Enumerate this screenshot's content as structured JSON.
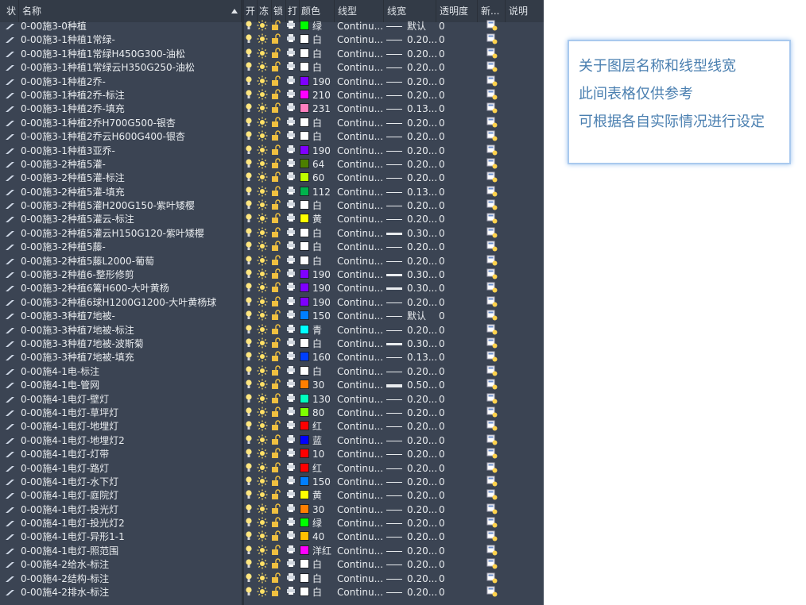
{
  "headers": {
    "status": "状",
    "name": "名称",
    "on": "开",
    "freeze": "冻",
    "lock": "锁",
    "plot": "打",
    "color": "颜色",
    "linetype": "线型",
    "lineweight": "线宽",
    "transparency": "透明度",
    "new_vp_freeze": "新...",
    "description": "说明"
  },
  "colors": {
    "panel_bg": "#3b4453",
    "header_bg": "#333b47",
    "note_text": "#4a7fb0",
    "note_border": "#a9c9ee"
  },
  "layers": [
    {
      "name": "0-00施3-0种植",
      "color_label": "绿",
      "swatch": "#00ff00",
      "linetype": "Continu...",
      "lineweight": "默认",
      "lw_weight": 1,
      "transparency": "0"
    },
    {
      "name": "0-00施3-1种植1常绿-",
      "color_label": "白",
      "swatch": "#ffffff",
      "linetype": "Continu...",
      "lineweight": "0.20...",
      "lw_weight": 1,
      "transparency": "0"
    },
    {
      "name": "0-00施3-1种植1常绿H450G300-油松",
      "color_label": "白",
      "swatch": "#ffffff",
      "linetype": "Continu...",
      "lineweight": "0.20...",
      "lw_weight": 1,
      "transparency": "0"
    },
    {
      "name": "0-00施3-1种植1常绿云H350G250-油松",
      "color_label": "白",
      "swatch": "#ffffff",
      "linetype": "Continu...",
      "lineweight": "0.20...",
      "lw_weight": 1,
      "transparency": "0"
    },
    {
      "name": "0-00施3-1种植2乔-",
      "color_label": "190",
      "swatch": "#7f00ff",
      "linetype": "Continu...",
      "lineweight": "0.20...",
      "lw_weight": 1,
      "transparency": "0"
    },
    {
      "name": "0-00施3-1种植2乔-标注",
      "color_label": "210",
      "swatch": "#ff00ff",
      "linetype": "Continu...",
      "lineweight": "0.20...",
      "lw_weight": 1,
      "transparency": "0"
    },
    {
      "name": "0-00施3-1种植2乔-填充",
      "color_label": "231",
      "swatch": "#ff7fbf",
      "linetype": "Continu...",
      "lineweight": "0.13...",
      "lw_weight": 1,
      "transparency": "0"
    },
    {
      "name": "0-00施3-1种植2乔H700G500-银杏",
      "color_label": "白",
      "swatch": "#ffffff",
      "linetype": "Continu...",
      "lineweight": "0.20...",
      "lw_weight": 1,
      "transparency": "0"
    },
    {
      "name": "0-00施3-1种植2乔云H600G400-银杏",
      "color_label": "白",
      "swatch": "#ffffff",
      "linetype": "Continu...",
      "lineweight": "0.20...",
      "lw_weight": 1,
      "transparency": "0"
    },
    {
      "name": "0-00施3-1种植3亚乔-",
      "color_label": "190",
      "swatch": "#7f00ff",
      "linetype": "Continu...",
      "lineweight": "0.20...",
      "lw_weight": 1,
      "transparency": "0"
    },
    {
      "name": "0-00施3-2种植5灌-",
      "color_label": "64",
      "swatch": "#4c7f00",
      "linetype": "Continu...",
      "lineweight": "0.20...",
      "lw_weight": 1,
      "transparency": "0"
    },
    {
      "name": "0-00施3-2种植5灌-标注",
      "color_label": "60",
      "swatch": "#bfff00",
      "linetype": "Continu...",
      "lineweight": "0.20...",
      "lw_weight": 1,
      "transparency": "0"
    },
    {
      "name": "0-00施3-2种植5灌-填充",
      "color_label": "112",
      "swatch": "#00b24c",
      "linetype": "Continu...",
      "lineweight": "0.13...",
      "lw_weight": 1,
      "transparency": "0"
    },
    {
      "name": "0-00施3-2种植5灌H200G150-紫叶矮樱",
      "color_label": "白",
      "swatch": "#ffffff",
      "linetype": "Continu...",
      "lineweight": "0.20...",
      "lw_weight": 1,
      "transparency": "0"
    },
    {
      "name": "0-00施3-2种植5灌云-标注",
      "color_label": "黄",
      "swatch": "#ffff00",
      "linetype": "Continu...",
      "lineweight": "0.20...",
      "lw_weight": 1,
      "transparency": "0"
    },
    {
      "name": "0-00施3-2种植5灌云H150G120-紫叶矮樱",
      "color_label": "白",
      "swatch": "#ffffff",
      "linetype": "Continu...",
      "lineweight": "0.30...",
      "lw_weight": 3,
      "transparency": "0"
    },
    {
      "name": "0-00施3-2种植5藤-",
      "color_label": "白",
      "swatch": "#ffffff",
      "linetype": "Continu...",
      "lineweight": "0.20...",
      "lw_weight": 1,
      "transparency": "0"
    },
    {
      "name": "0-00施3-2种植5藤L2000-葡萄",
      "color_label": "白",
      "swatch": "#ffffff",
      "linetype": "Continu...",
      "lineweight": "0.20...",
      "lw_weight": 1,
      "transparency": "0"
    },
    {
      "name": "0-00施3-2种植6-整形修剪",
      "color_label": "190",
      "swatch": "#7f00ff",
      "linetype": "Continu...",
      "lineweight": "0.30...",
      "lw_weight": 3,
      "transparency": "0"
    },
    {
      "name": "0-00施3-2种植6篱H600-大叶黄杨",
      "color_label": "190",
      "swatch": "#7f00ff",
      "linetype": "Continu...",
      "lineweight": "0.30...",
      "lw_weight": 3,
      "transparency": "0"
    },
    {
      "name": "0-00施3-2种植6球H1200G1200-大叶黄杨球",
      "color_label": "190",
      "swatch": "#7f00ff",
      "linetype": "Continu...",
      "lineweight": "0.20...",
      "lw_weight": 1,
      "transparency": "0"
    },
    {
      "name": "0-00施3-3种植7地被-",
      "color_label": "150",
      "swatch": "#007fff",
      "linetype": "Continu...",
      "lineweight": "默认",
      "lw_weight": 1,
      "transparency": "0"
    },
    {
      "name": "0-00施3-3种植7地被-标注",
      "color_label": "青",
      "swatch": "#00ffff",
      "linetype": "Continu...",
      "lineweight": "0.20...",
      "lw_weight": 1,
      "transparency": "0"
    },
    {
      "name": "0-00施3-3种植7地被-波斯菊",
      "color_label": "白",
      "swatch": "#ffffff",
      "linetype": "Continu...",
      "lineweight": "0.30...",
      "lw_weight": 3,
      "transparency": "0"
    },
    {
      "name": "0-00施3-3种植7地被-填充",
      "color_label": "160",
      "swatch": "#003fff",
      "linetype": "Continu...",
      "lineweight": "0.13...",
      "lw_weight": 1,
      "transparency": "0"
    },
    {
      "name": "0-00施4-1电-标注",
      "color_label": "白",
      "swatch": "#ffffff",
      "linetype": "Continu...",
      "lineweight": "0.20...",
      "lw_weight": 1,
      "transparency": "0"
    },
    {
      "name": "0-00施4-1电-管网",
      "color_label": "30",
      "swatch": "#ff7f00",
      "linetype": "Continu...",
      "lineweight": "0.50...",
      "lw_weight": 4,
      "transparency": "0"
    },
    {
      "name": "0-00施4-1电灯-壁灯",
      "color_label": "130",
      "swatch": "#00ffbf",
      "linetype": "Continu...",
      "lineweight": "0.20...",
      "lw_weight": 1,
      "transparency": "0"
    },
    {
      "name": "0-00施4-1电灯-草坪灯",
      "color_label": "80",
      "swatch": "#7fff00",
      "linetype": "Continu...",
      "lineweight": "0.20...",
      "lw_weight": 1,
      "transparency": "0"
    },
    {
      "name": "0-00施4-1电灯-地埋灯",
      "color_label": "红",
      "swatch": "#ff0000",
      "linetype": "Continu...",
      "lineweight": "0.20...",
      "lw_weight": 1,
      "transparency": "0"
    },
    {
      "name": "0-00施4-1电灯-地埋灯2",
      "color_label": "蓝",
      "swatch": "#0000ff",
      "linetype": "Continu...",
      "lineweight": "0.20...",
      "lw_weight": 1,
      "transparency": "0"
    },
    {
      "name": "0-00施4-1电灯-灯带",
      "color_label": "10",
      "swatch": "#ff0000",
      "linetype": "Continu...",
      "lineweight": "0.20...",
      "lw_weight": 1,
      "transparency": "0"
    },
    {
      "name": "0-00施4-1电灯-路灯",
      "color_label": "红",
      "swatch": "#ff0000",
      "linetype": "Continu...",
      "lineweight": "0.20...",
      "lw_weight": 1,
      "transparency": "0"
    },
    {
      "name": "0-00施4-1电灯-水下灯",
      "color_label": "150",
      "swatch": "#007fff",
      "linetype": "Continu...",
      "lineweight": "0.20...",
      "lw_weight": 1,
      "transparency": "0"
    },
    {
      "name": "0-00施4-1电灯-庭院灯",
      "color_label": "黄",
      "swatch": "#ffff00",
      "linetype": "Continu...",
      "lineweight": "0.20...",
      "lw_weight": 1,
      "transparency": "0"
    },
    {
      "name": "0-00施4-1电灯-投光灯",
      "color_label": "30",
      "swatch": "#ff7f00",
      "linetype": "Continu...",
      "lineweight": "0.20...",
      "lw_weight": 1,
      "transparency": "0"
    },
    {
      "name": "0-00施4-1电灯-投光灯2",
      "color_label": "绿",
      "swatch": "#00ff00",
      "linetype": "Continu...",
      "lineweight": "0.20...",
      "lw_weight": 1,
      "transparency": "0"
    },
    {
      "name": "0-00施4-1电灯-异形1-1",
      "color_label": "40",
      "swatch": "#ffbf00",
      "linetype": "Continu...",
      "lineweight": "0.20...",
      "lw_weight": 1,
      "transparency": "0"
    },
    {
      "name": "0-00施4-1电灯-照范围",
      "color_label": "洋红",
      "swatch": "#ff00ff",
      "linetype": "Continu...",
      "lineweight": "0.20...",
      "lw_weight": 1,
      "transparency": "0"
    },
    {
      "name": "0-00施4-2给水-标注",
      "color_label": "白",
      "swatch": "#ffffff",
      "linetype": "Continu...",
      "lineweight": "0.20...",
      "lw_weight": 1,
      "transparency": "0"
    },
    {
      "name": "0-00施4-2结构-标注",
      "color_label": "白",
      "swatch": "#ffffff",
      "linetype": "Continu...",
      "lineweight": "0.20...",
      "lw_weight": 1,
      "transparency": "0"
    },
    {
      "name": "0-00施4-2排水-标注",
      "color_label": "白",
      "swatch": "#ffffff",
      "linetype": "Continu...",
      "lineweight": "0.20...",
      "lw_weight": 1,
      "transparency": "0"
    }
  ],
  "note": {
    "lines": [
      "关于图层名称和线型线宽",
      "此间表格仅供参考",
      "可根据各自实际情况进行设定"
    ]
  }
}
